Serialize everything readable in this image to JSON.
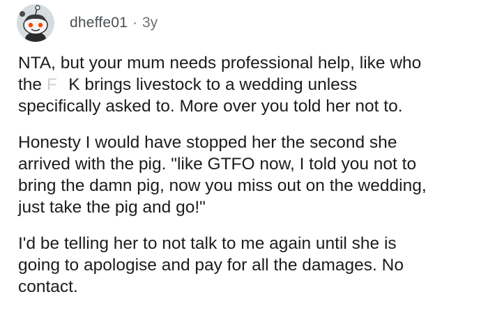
{
  "comment": {
    "author": "dheffe01",
    "separator": "·",
    "age": "3y",
    "avatar_icon": "snoo-avatar-icon",
    "paragraphs": [
      {
        "lines": [
          {
            "text": "NTA, but your mum needs professional help, like who"
          },
          {
            "pre": "the ",
            "censored": "F   ",
            "post": "K brings livestock to a wedding unless"
          },
          {
            "text": "specifically asked to.  More over you told her not to."
          }
        ]
      },
      {
        "lines": [
          {
            "text": "Honesty I would have stopped her the second she"
          },
          {
            "text": "arrived with the pig. \"like GTFO now, I told you not to"
          },
          {
            "text": "bring the damn pig, now  you miss out on the wedding,"
          },
          {
            "text": "just take the pig and go!\""
          }
        ]
      },
      {
        "lines": [
          {
            "text": "I'd be telling her to not talk to me again until she is"
          },
          {
            "text": "going to apologise and pay for all the damages.  No"
          },
          {
            "text": "contact."
          }
        ]
      }
    ]
  }
}
